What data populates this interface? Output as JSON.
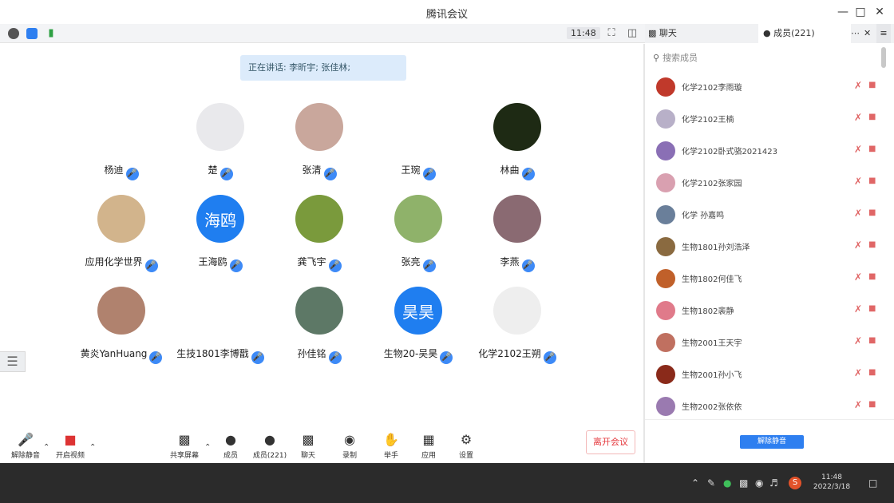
{
  "window": {
    "title": "腾讯会议"
  },
  "top_toolbar": {
    "clock": "11:48"
  },
  "side_tabs": {
    "chat": "聊天",
    "members": "成员(221)"
  },
  "notice": "正在讲话: 李昕宇; 张佳林;",
  "participants": [
    {
      "name": "杨迪",
      "bg": "#ffffff",
      "label": ""
    },
    {
      "name": "楚",
      "bg": "#e9e9ec",
      "label": ""
    },
    {
      "name": "张清",
      "bg": "#c9a79c",
      "label": ""
    },
    {
      "name": "王琬",
      "bg": "#ffffff",
      "label": ""
    },
    {
      "name": "林曲",
      "bg": "#1e2a14",
      "label": ""
    },
    {
      "name": "应用化学世界",
      "bg": "#d2b48c",
      "label": ""
    },
    {
      "name": "王海鸥",
      "bg": "#1f7ef0",
      "label": "海鸥"
    },
    {
      "name": "龚飞宇",
      "bg": "#7a9a3c",
      "label": ""
    },
    {
      "name": "张亮",
      "bg": "#8fb26a",
      "label": ""
    },
    {
      "name": "李燕",
      "bg": "#8a6a72",
      "label": ""
    },
    {
      "name": "黄炎YanHuang",
      "bg": "#b0826e",
      "label": ""
    },
    {
      "name": "生技1801李博戬",
      "bg": "#ffffff",
      "label": ""
    },
    {
      "name": "孙佳铭",
      "bg": "#5d7866",
      "label": ""
    },
    {
      "name": "生物20-吴昊",
      "bg": "#1f7ef0",
      "label": "昊昊"
    },
    {
      "name": "化学2102王朔",
      "bg": "#eeeeee",
      "label": ""
    }
  ],
  "members": [
    {
      "name": "化学2102李雨璇",
      "color": "#c0392b"
    },
    {
      "name": "化学2102王楠",
      "color": "#b8b0c8"
    },
    {
      "name": "化学2102卧式骆2021423",
      "color": "#8a6fb5"
    },
    {
      "name": "化学2102张家园",
      "color": "#d9a0b0"
    },
    {
      "name": "化学 孙嘉鸣",
      "color": "#6a7f9a"
    },
    {
      "name": "生物1801孙刘浩泽",
      "color": "#8a6a40"
    },
    {
      "name": "生物1802何佳飞",
      "color": "#c0602a"
    },
    {
      "name": "生物1802裴静",
      "color": "#e07a8a"
    },
    {
      "name": "生物2001王天宇",
      "color": "#c07060"
    },
    {
      "name": "生物2001孙小飞",
      "color": "#8a2a1a"
    },
    {
      "name": "生物2002张依依",
      "color": "#9a7ab0"
    }
  ],
  "search_placeholder": "搜索成员",
  "mute_all": "解除静音",
  "bottom": {
    "mute": "解除静音",
    "video": "开启视频",
    "share": "共享屏幕",
    "members": "成员",
    "invite": "成员(221)",
    "chat": "聊天",
    "record": "录制",
    "hand": "举手",
    "apps": "应用",
    "settings": "设置",
    "leave": "离开会议"
  },
  "taskbar": {
    "time": "11:48",
    "date": "2022/3/18"
  }
}
